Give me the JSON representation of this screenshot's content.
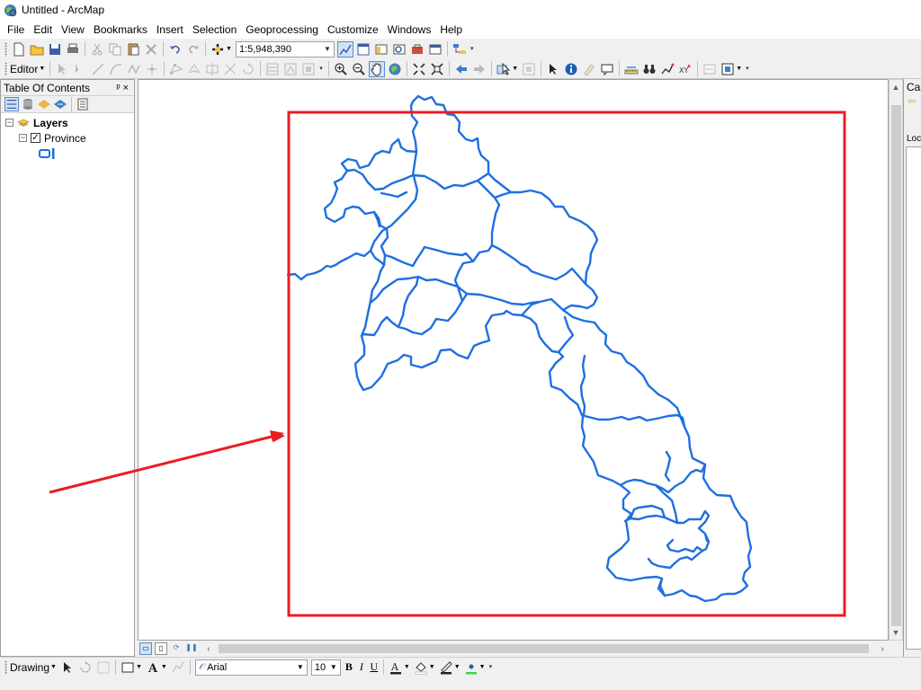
{
  "window": {
    "title": "Untitled - ArcMap"
  },
  "menu": [
    "File",
    "Edit",
    "View",
    "Bookmarks",
    "Insert",
    "Selection",
    "Geoprocessing",
    "Customize",
    "Windows",
    "Help"
  ],
  "standard_toolbar": {
    "scale": "1:5,948,390"
  },
  "editor_toolbar": {
    "label": "Editor"
  },
  "toc": {
    "title": "Table Of Contents",
    "pin_glyph": "p",
    "close_glyph": "×",
    "root_label": "Layers",
    "layer_label": "Province",
    "layer_checked": true,
    "symbol_color": "#1f6fe0"
  },
  "map": {
    "layer_outline_color": "#1f6fe0",
    "extent_box_color": "#ec1c24",
    "arrow_color": "#ec1c24"
  },
  "catalog": {
    "title": "Ca",
    "location_label": "Loc"
  },
  "drawing_toolbar": {
    "label": "Drawing",
    "font": "Arial",
    "font_size": "10"
  }
}
